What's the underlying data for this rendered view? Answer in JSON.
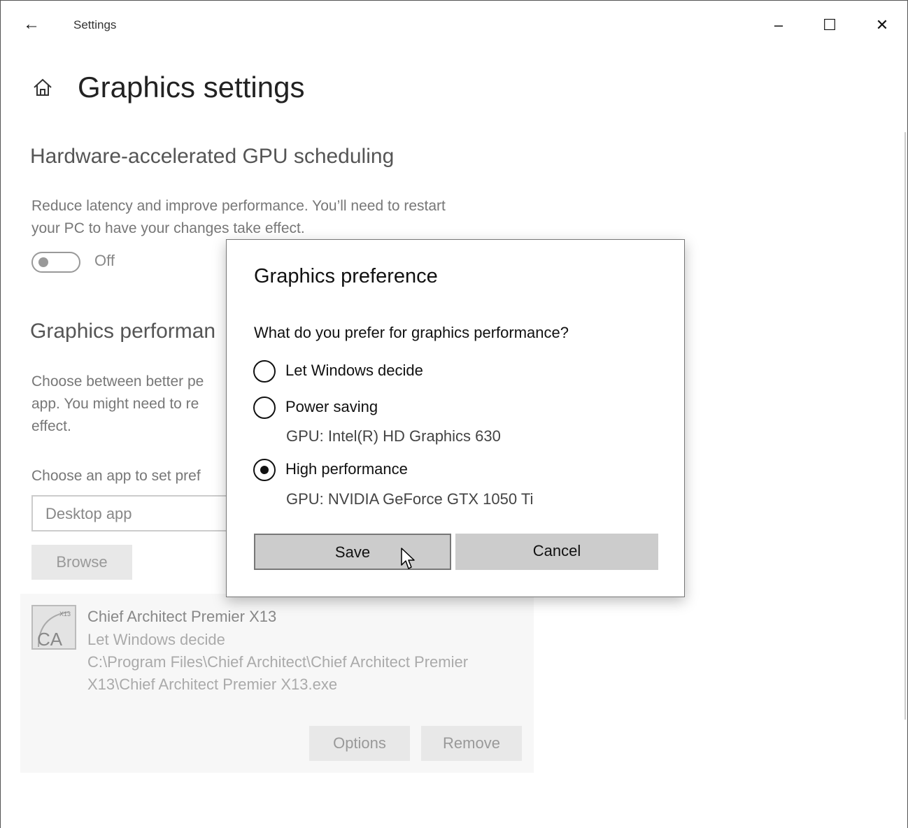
{
  "window": {
    "title": "Settings",
    "controls": {
      "minimize": "–",
      "maximize": "☐",
      "close": "✕"
    }
  },
  "header": {
    "title": "Graphics settings",
    "back_icon": "←"
  },
  "gpu_scheduling": {
    "title": "Hardware-accelerated GPU scheduling",
    "description_line1": "Reduce latency and improve performance. You’ll need to restart",
    "description_line2": "your PC to have your changes take effect.",
    "toggle_label": "Off"
  },
  "graphics_performance": {
    "title": "Graphics performan",
    "description_line1": "Choose between better pe",
    "description_line2": "app. You might need to re",
    "description_line3": "effect.",
    "choose_label": "Choose an app to set pref",
    "app_type": "Desktop app",
    "browse_label": "Browse"
  },
  "app_card": {
    "name": "Chief Architect Premier X13",
    "preference": "Let Windows decide",
    "path_line1": "C:\\Program Files\\Chief Architect\\Chief Architect Premier",
    "path_line2": "X13\\Chief Architect Premier X13.exe",
    "icon_badge": "X13",
    "icon_letters": "CA",
    "options_label": "Options",
    "remove_label": "Remove"
  },
  "dialog": {
    "title": "Graphics preference",
    "question": "What do you prefer for graphics performance?",
    "options": [
      {
        "label": "Let Windows decide",
        "gpu": "",
        "selected": false
      },
      {
        "label": "Power saving",
        "gpu": "GPU: Intel(R) HD Graphics 630",
        "selected": false
      },
      {
        "label": "High performance",
        "gpu": "GPU: NVIDIA GeForce GTX 1050 Ti",
        "selected": true
      }
    ],
    "save_label": "Save",
    "cancel_label": "Cancel"
  }
}
